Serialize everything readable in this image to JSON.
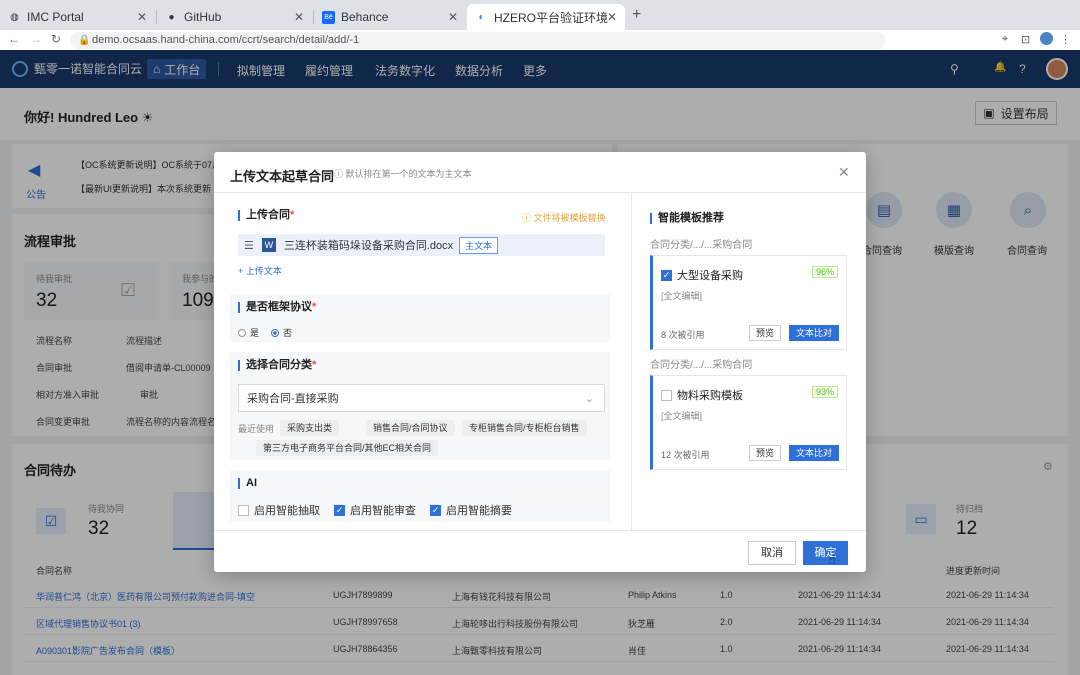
{
  "browser": {
    "tabs": [
      {
        "title": "IMC Portal",
        "icon": "globe-icon"
      },
      {
        "title": "GitHub",
        "icon": "github-icon"
      },
      {
        "title": "Behance",
        "icon": "behance-icon"
      },
      {
        "title": "HZERO平台验证环境",
        "icon": "hzero-icon"
      }
    ],
    "url": "demo.ocsaas.hand-china.com/ccrt/search/detail/add/-1"
  },
  "appbar": {
    "brand": "甄零一诺智能合同云",
    "nav": [
      "工作台",
      "拟制管理",
      "履约管理",
      "法务数字化",
      "数据分析",
      "更多"
    ]
  },
  "page": {
    "greeting": "你好! Hundred Leo ☀",
    "layout_button": "设置布局",
    "notice_label": "公告",
    "notice_lines": [
      "【OC系统更新说明】OC系统于07月",
      "【最新UI更新说明】本次系统更新"
    ],
    "flow_title": "流程审批",
    "flow_stats": [
      {
        "label": "待我审批",
        "value": "32"
      },
      {
        "label": "我参与的",
        "value": "109"
      }
    ],
    "flow_cols": [
      "流程名称",
      "流程描述"
    ],
    "flow_rows": [
      {
        "name": "合同审批",
        "desc": "借阅申请单-CL00009"
      },
      {
        "name": "相对方准入审批",
        "desc": "审批"
      },
      {
        "name": "合同变更审批",
        "desc": "流程名称的内容流程名"
      }
    ],
    "quick": [
      "合同查询",
      "模版查询",
      "合同查询"
    ],
    "todo_title": "合同待办",
    "todo_stats": [
      {
        "label": "待我协同",
        "value": "32"
      },
      {
        "label": "待归档",
        "value": "12"
      }
    ],
    "table_cols": [
      "合同名称",
      "进度更新时间"
    ],
    "table_rows": [
      [
        "华润普仁鸿（北京）医药有限公司预付款购进合同-填空",
        "UGJH7899899",
        "上海有钱花科技有限公司",
        "Philip Atkins",
        "1.0",
        "2021-06-29 11:14:34",
        "2021-06-29 11:14:34"
      ],
      [
        "区域代理销售协议书01 (3)",
        "UGJH78997658",
        "上海轮哆出行科技股份有限公司",
        "狄芝雁",
        "2.0",
        "2021-06-29 11:14:34",
        "2021-06-29 11:14:34"
      ],
      [
        "A090301影院广告发布合同（模板）",
        "UGJH78864356",
        "上海甄零科技有限公司",
        "肖佳",
        "1.0",
        "2021-06-29 11:14:34",
        "2021-06-29 11:14:34"
      ]
    ]
  },
  "modal": {
    "title": "上传文本起草合同",
    "hint": "默认排在第一个的文本为主文本",
    "upload": {
      "title": "上传合同",
      "warning": "文件将被模板替换",
      "file_name": "三连杯装箱码垛设备采购合同.docx",
      "main_tag": "主文本",
      "add_link": "+ 上传文本"
    },
    "frame": {
      "title": "是否框架协议",
      "options": [
        "是",
        "否"
      ],
      "selected": "否"
    },
    "category": {
      "title": "选择合同分类",
      "value": "采购合同-直接采购",
      "recent_label": "最近使用",
      "chips": [
        "采购支出类",
        "销售合同/合同协议",
        "专柜销售合同/专柜柜台销售",
        "第三方电子商务平台合同/其他EC相关合同"
      ]
    },
    "ai": {
      "title": "AI",
      "items": [
        {
          "label": "启用智能抽取",
          "checked": false
        },
        {
          "label": "启用智能审查",
          "checked": true
        },
        {
          "label": "启用智能摘要",
          "checked": true
        }
      ]
    },
    "recommend": {
      "title": "智能模板推荐",
      "templates": [
        {
          "path": "合同分类/.../...采购合同",
          "name": "大型设备采购",
          "percent": "96%",
          "sub": "[全文编辑]",
          "usage": "8 次被引用",
          "checked": true
        },
        {
          "path": "合同分类/.../...采购合同",
          "name": "物料采购模板",
          "percent": "93%",
          "sub": "[全文编辑]",
          "usage": "12 次被引用",
          "checked": false
        }
      ],
      "preview_label": "预览",
      "compare_label": "文本比对"
    },
    "cancel": "取消",
    "confirm": "确定"
  }
}
